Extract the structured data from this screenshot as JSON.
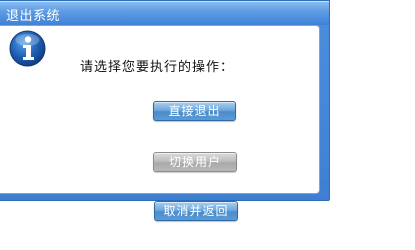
{
  "window": {
    "title": "退出系统"
  },
  "dialog": {
    "icon": "info-icon",
    "prompt": "请选择您要执行的操作：",
    "buttons": {
      "exit_label": "直接退出",
      "switch_user_label": "切换用户",
      "cancel_label": "取消并返回"
    }
  },
  "colors": {
    "title_bar": "#4b8ddc",
    "button_blue": "#5b9ad6",
    "button_disabled": "#b8b8b8"
  }
}
